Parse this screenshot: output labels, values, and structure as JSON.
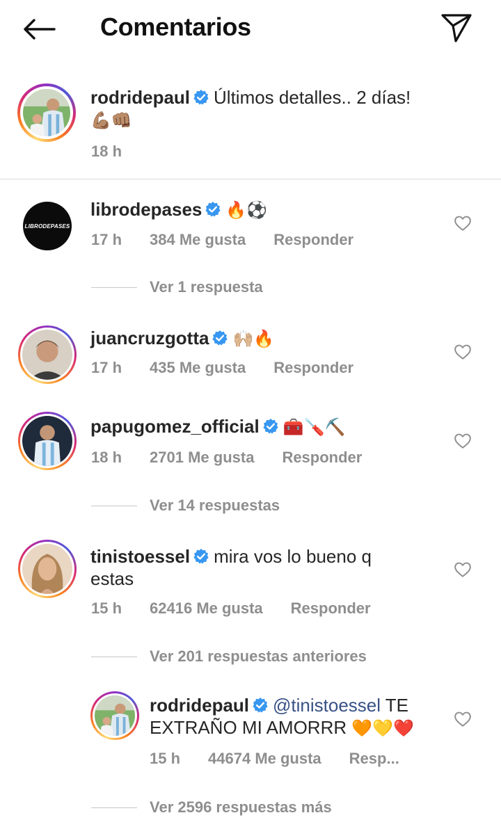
{
  "header": {
    "title": "Comentarios"
  },
  "caption": {
    "username": "rodridepaul",
    "text": "Últimos detalles.. 2 días!",
    "emojis": "💪🏽👊🏽",
    "time": "18 h"
  },
  "comments": [
    {
      "username": "librodepases",
      "avatar_text": "LIBRODEPASES",
      "text": "🔥⚽",
      "time": "17 h",
      "likes": "384 Me gusta",
      "reply": "Responder",
      "view_replies": "Ver 1 respuesta"
    },
    {
      "username": "juancruzgotta",
      "text": "🙌🏼🔥",
      "time": "17 h",
      "likes": "435 Me gusta",
      "reply": "Responder"
    },
    {
      "username": "papugomez_official",
      "text": "🧰🪛⛏️",
      "time": "18 h",
      "likes": "2701 Me gusta",
      "reply": "Responder",
      "view_replies": "Ver 14 respuestas"
    },
    {
      "username": "tinistoessel",
      "text": "mira vos lo bueno q estas",
      "time": "15 h",
      "likes": "62416 Me gusta",
      "reply": "Responder",
      "view_replies": "Ver 201 respuestas anteriores"
    }
  ],
  "reply": {
    "username": "rodridepaul",
    "mention": "@tinistoessel",
    "text": "TE EXTRAÑO MI AMORRR",
    "emojis": "🧡💛❤️",
    "time": "15 h",
    "likes": "44674 Me gusta",
    "reply": "Resp...",
    "view_more": "Ver 2596 respuestas más"
  },
  "colors": {
    "verified": "#3897f0",
    "meta": "#8e8e8e",
    "text": "#262626"
  }
}
